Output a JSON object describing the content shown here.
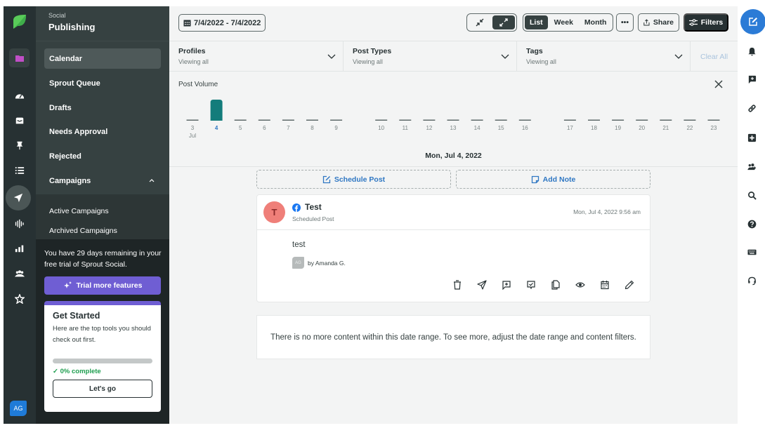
{
  "app": {
    "section_eyebrow": "Social",
    "section_title": "Publishing",
    "accent_colors": {
      "brand_green": "#59cb59",
      "purple": "#6f5ed3",
      "blue": "#2b7bd6",
      "teal_bar": "#137c7b"
    }
  },
  "left_rail": {
    "icons": [
      "sprout-logo",
      "folder-icon",
      "dashboard-icon",
      "inbox-icon",
      "pin-icon",
      "list-icon",
      "publishing-icon",
      "listening-icon",
      "reports-icon",
      "people-icon",
      "star-icon"
    ],
    "avatar_initials": "AG"
  },
  "sidebar": {
    "items": [
      {
        "label": "Calendar",
        "active": true
      },
      {
        "label": "Sprout Queue"
      },
      {
        "label": "Drafts"
      },
      {
        "label": "Needs Approval"
      },
      {
        "label": "Rejected"
      },
      {
        "label": "Campaigns"
      }
    ],
    "campaigns_sub": [
      "Active Campaigns",
      "Archived Campaigns"
    ],
    "trial_text": "You have 29 days remaining in your free trial of Sprout Social.",
    "trial_button": "Trial more features",
    "get_started": {
      "title": "Get Started",
      "description": "Here are the top tools you should check out first.",
      "progress_percent": 0,
      "progress_label": "0% complete",
      "button": "Let's go"
    }
  },
  "toolbar": {
    "date_range": "7/4/2022 - 7/4/2022",
    "view_options": [
      "List",
      "Week",
      "Month"
    ],
    "selected_view": "List",
    "more_label": "•••",
    "share_label": "Share",
    "filters_label": "Filters"
  },
  "filters": [
    {
      "label": "Profiles",
      "value": "Viewing all"
    },
    {
      "label": "Post Types",
      "value": "Viewing all"
    },
    {
      "label": "Tags",
      "value": "Viewing all"
    }
  ],
  "clear_all_label": "Clear All",
  "post_volume": {
    "title": "Post Volume",
    "selected_date_label": "Mon, Jul 4, 2022"
  },
  "chart_data": {
    "type": "bar",
    "title": "Post Volume",
    "month_label": "Jul",
    "categories": [
      "3",
      "4",
      "5",
      "6",
      "7",
      "8",
      "9",
      "10",
      "11",
      "12",
      "13",
      "14",
      "15",
      "16",
      "17",
      "18",
      "19",
      "20",
      "21",
      "22",
      "23"
    ],
    "values": [
      0,
      1,
      0,
      0,
      0,
      0,
      0,
      0,
      0,
      0,
      0,
      0,
      0,
      0,
      0,
      0,
      0,
      0,
      0,
      0,
      0
    ],
    "selected": "4",
    "week_breaks_after": [
      "9",
      "16"
    ]
  },
  "actions": {
    "schedule_post": "Schedule Post",
    "add_note": "Add Note"
  },
  "post": {
    "avatar_initial": "T",
    "network": "facebook",
    "name": "Test",
    "status": "Scheduled Post",
    "timestamp": "Mon, Jul 4, 2022 9:56 am",
    "body": "test",
    "author_initials": "AG",
    "author": "by Amanda G.",
    "tools": [
      "trash-icon",
      "send-icon",
      "comment-add-icon",
      "comment-check-icon",
      "duplicate-icon",
      "preview-icon",
      "reschedule-icon",
      "edit-icon"
    ]
  },
  "end_message": "There is no more content within this date range. To see more, adjust the date range and content filters.",
  "right_rail": {
    "icons": [
      "compose-icon",
      "bell-icon",
      "feedback-icon",
      "link-icon",
      "add-icon",
      "team-icon",
      "search-icon",
      "help-icon",
      "keyboard-icon",
      "support-icon"
    ]
  }
}
